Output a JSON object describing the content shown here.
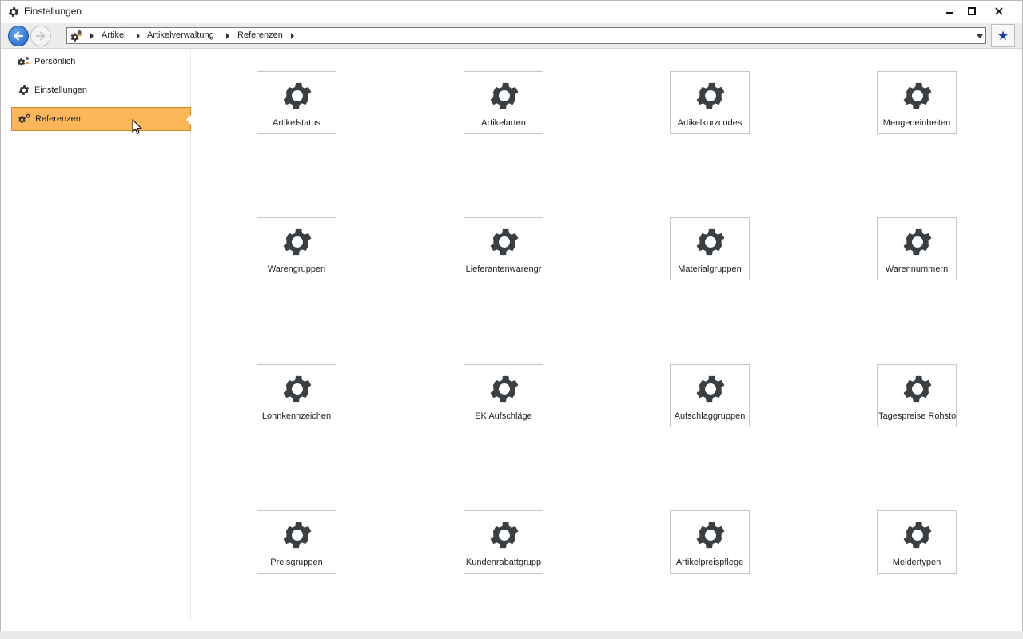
{
  "window": {
    "title": "Einstellungen",
    "icons": {
      "title": "gear-icon",
      "minimize": "minimize-icon",
      "maximize": "maximize-icon",
      "close": "close-icon"
    }
  },
  "navbar": {
    "breadcrumb": [
      "Artikel",
      "Artikelverwaltung",
      "Referenzen"
    ],
    "favorite_icon": "star-icon"
  },
  "sidebar": {
    "items": [
      {
        "label": "Persönlich",
        "icon": "user-gear-icon",
        "active": false
      },
      {
        "label": "Einstellungen",
        "icon": "gear-icon",
        "active": false
      },
      {
        "label": "Referenzen",
        "icon": "reference-gear-icon",
        "active": true
      }
    ]
  },
  "tiles": [
    {
      "label": "Artikelstatus"
    },
    {
      "label": "Artikelarten"
    },
    {
      "label": "Artikelkurzcodes"
    },
    {
      "label": "Mengeneinheiten"
    },
    {
      "label": "Warengruppen"
    },
    {
      "label": "Lieferantenwarengr"
    },
    {
      "label": "Materialgruppen"
    },
    {
      "label": "Warennummern"
    },
    {
      "label": "Lohnkennzeichen"
    },
    {
      "label": "EK Aufschläge"
    },
    {
      "label": "Aufschlaggruppen"
    },
    {
      "label": "Tagespreise Rohstof"
    },
    {
      "label": "Preisgruppen"
    },
    {
      "label": "Kundenrabattgrupp"
    },
    {
      "label": "Artikelpreispflege"
    },
    {
      "label": "Meldertypen"
    }
  ],
  "colors": {
    "active_item": "#fdb65a",
    "icon_dark": "#3a3f44",
    "accent_blue": "#1f5fbf"
  }
}
